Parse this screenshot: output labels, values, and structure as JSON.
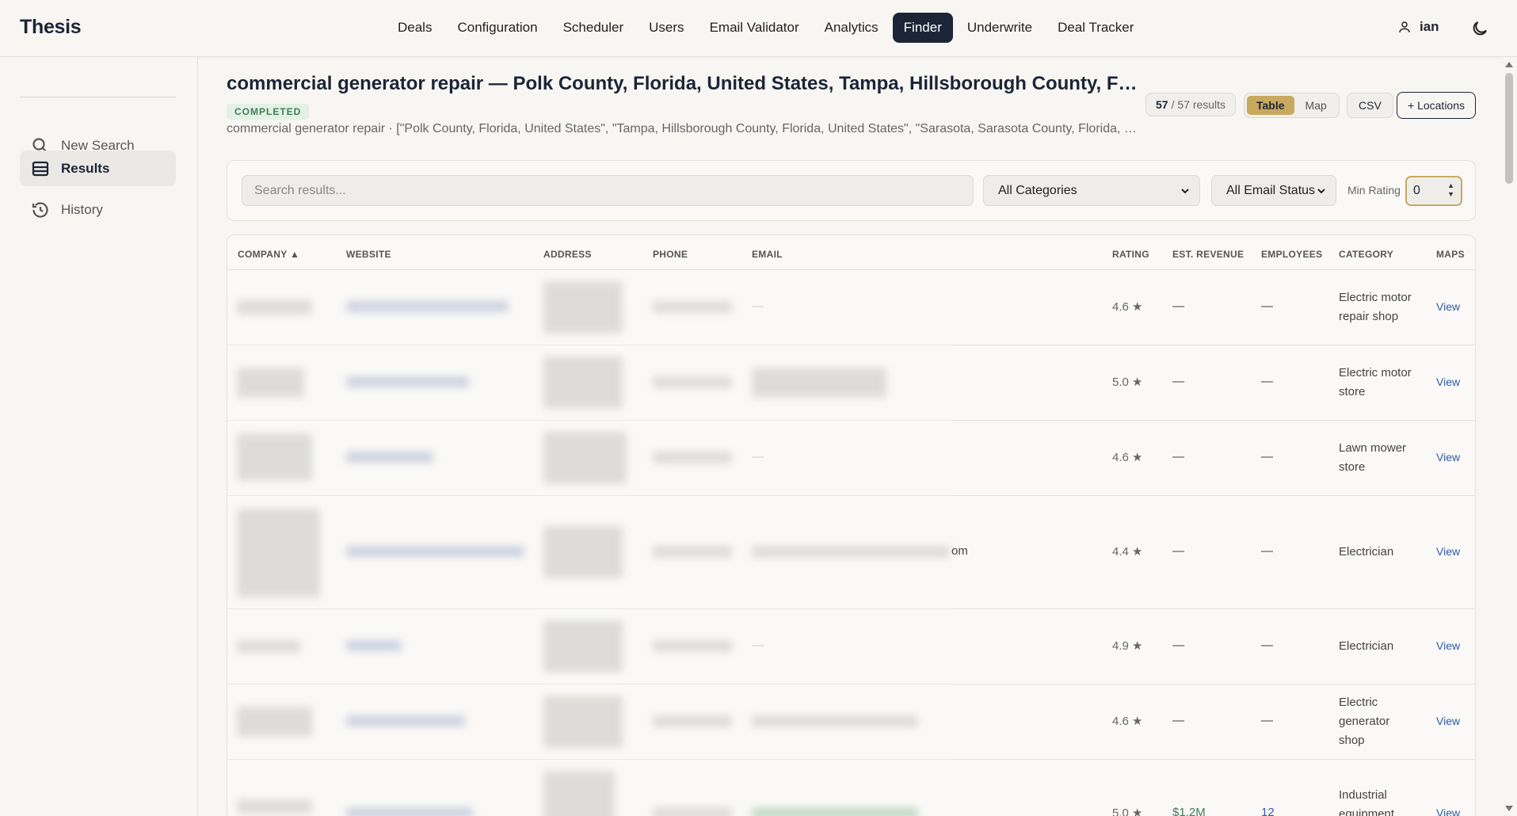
{
  "app": {
    "logo": "Thesis"
  },
  "nav": {
    "items": [
      "Deals",
      "Configuration",
      "Scheduler",
      "Users",
      "Email Validator",
      "Analytics",
      "Finder",
      "Underwrite",
      "Deal Tracker"
    ],
    "active": "Finder"
  },
  "user": {
    "name": "ian"
  },
  "sidebar": {
    "items": [
      {
        "label": "New Search",
        "icon": "search-icon"
      },
      {
        "label": "Results",
        "icon": "table-icon",
        "active": true
      },
      {
        "label": "History",
        "icon": "history-icon"
      }
    ]
  },
  "search": {
    "title": "commercial generator repair — Polk County, Florida, United States, Tampa, Hillsborough County, Florida, United States, Sarasota, Sarasota County, Florida, United States",
    "status": "COMPLETED",
    "subtitle": "commercial generator repair · [\"Polk County, Florida, United States\", \"Tampa, Hillsborough County, Florida, United States\", \"Sarasota, Sarasota County, Florida, United States\"]"
  },
  "toolbar": {
    "results_count": "57",
    "results_total": "/ 57 results",
    "view_table": "Table",
    "view_map": "Map",
    "active_view": "Table",
    "csv": "CSV",
    "add_locations": "+ Locations"
  },
  "filters": {
    "search_placeholder": "Search results...",
    "category": "All Categories",
    "email_status": "All Email Status",
    "min_rating_label": "Min Rating",
    "min_rating_value": "0"
  },
  "table": {
    "columns": [
      "COMPANY ▲",
      "WEBSITE",
      "ADDRESS",
      "PHONE",
      "EMAIL",
      "RATING",
      "EST. REVENUE",
      "EMPLOYEES",
      "CATEGORY",
      "MAPS"
    ],
    "rows": [
      {
        "email_tail": "—",
        "rating": "4.6 ★",
        "revenue": "—",
        "employees": "—",
        "category": "Electric motor repair shop",
        "maps": "View"
      },
      {
        "email_tail": "",
        "rating": "5.0 ★",
        "revenue": "—",
        "employees": "—",
        "category": "Electric motor store",
        "maps": "View"
      },
      {
        "email_tail": "—",
        "rating": "4.6 ★",
        "revenue": "—",
        "employees": "—",
        "category": "Lawn mower store",
        "maps": "View"
      },
      {
        "email_tail": "om",
        "rating": "4.4 ★",
        "revenue": "—",
        "employees": "—",
        "category": "Electrician",
        "maps": "View"
      },
      {
        "email_tail": "—",
        "rating": "4.9 ★",
        "revenue": "—",
        "employees": "—",
        "category": "Electrician",
        "maps": "View"
      },
      {
        "email_tail": "",
        "rating": "4.6 ★",
        "revenue": "—",
        "employees": "—",
        "category": "Electric generator shop",
        "maps": "View"
      },
      {
        "email_tail": "",
        "rating": "5.0 ★",
        "revenue": "$1.2M",
        "employees": "12",
        "category": "Industrial equipment supplier",
        "maps": "View"
      }
    ]
  },
  "colors": {
    "brand_dark": "#1c2537",
    "accent_gold": "#c9a95e",
    "status_green": "#3f7d55",
    "link_blue": "#2f5aa8"
  }
}
